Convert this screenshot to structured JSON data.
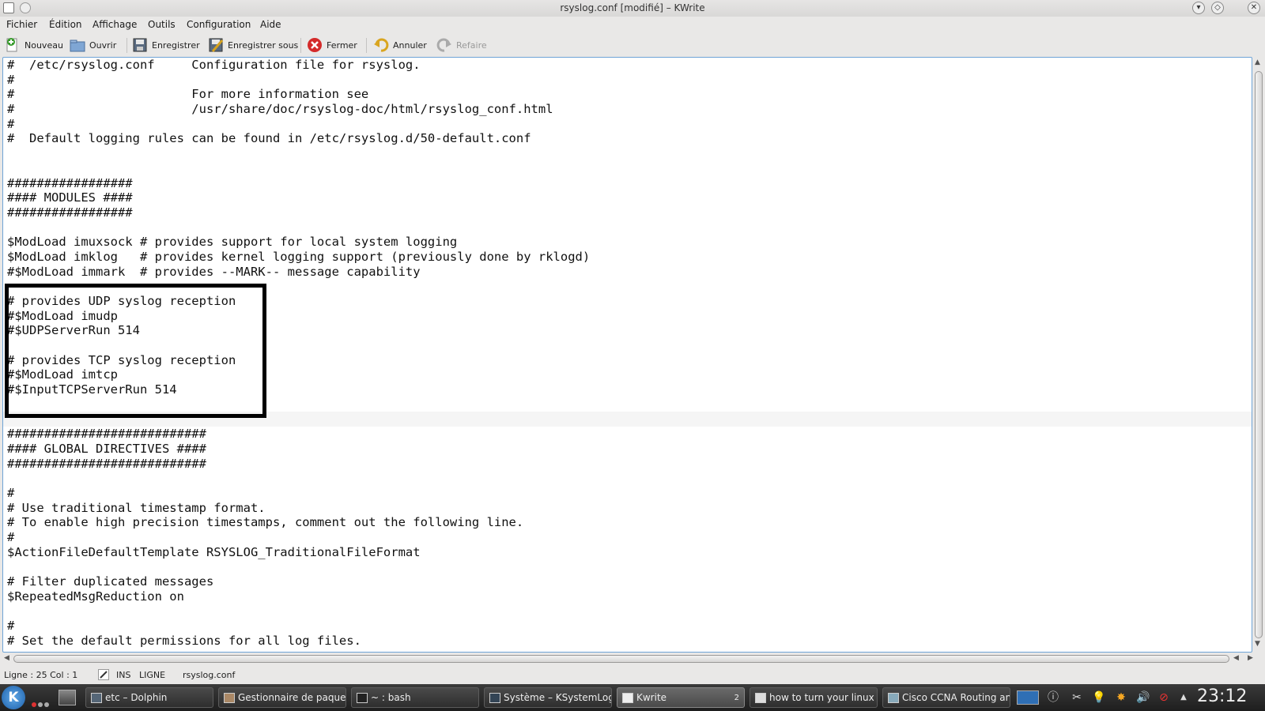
{
  "window": {
    "title": "rsyslog.conf [modifié] – KWrite"
  },
  "menu": {
    "items": [
      "Fichier",
      "Édition",
      "Affichage",
      "Outils",
      "Configuration",
      "Aide"
    ]
  },
  "toolbar": {
    "new_label": "Nouveau",
    "open_label": "Ouvrir",
    "save_label": "Enregistrer",
    "save_as_label": "Enregistrer sous",
    "close_label": "Fermer",
    "undo_label": "Annuler",
    "redo_label": "Refaire"
  },
  "editor": {
    "lines": [
      "#  /etc/rsyslog.conf     Configuration file for rsyslog.",
      "#",
      "#                        For more information see",
      "#                        /usr/share/doc/rsyslog-doc/html/rsyslog_conf.html",
      "#",
      "#  Default logging rules can be found in /etc/rsyslog.d/50-default.conf",
      "",
      "",
      "#################",
      "#### MODULES ####",
      "#################",
      "",
      "$ModLoad imuxsock # provides support for local system logging",
      "$ModLoad imklog   # provides kernel logging support (previously done by rklogd)",
      "#$ModLoad immark  # provides --MARK-- message capability",
      "",
      "# provides UDP syslog reception",
      "#$ModLoad imudp",
      "#$UDPServerRun 514",
      "",
      "# provides TCP syslog reception",
      "#$ModLoad imtcp",
      "#$InputTCPServerRun 514",
      "",
      "",
      "###########################",
      "#### GLOBAL DIRECTIVES ####",
      "###########################",
      "",
      "#",
      "# Use traditional timestamp format.",
      "# To enable high precision timestamps, comment out the following line.",
      "#",
      "$ActionFileDefaultTemplate RSYSLOG_TraditionalFileFormat",
      "",
      "# Filter duplicated messages",
      "$RepeatedMsgReduction on",
      "",
      "#",
      "# Set the default permissions for all log files."
    ]
  },
  "statusbar": {
    "position": "Ligne : 25 Col : 1",
    "mode": "INS",
    "selection_mode": "LIGNE",
    "filename": "rsyslog.conf"
  },
  "taskbar": {
    "tasks": [
      "etc – Dolphin",
      "Gestionnaire de paqueta",
      "~ : bash",
      "Système – KSystemLog",
      "Kwrite",
      "how to turn your linux co",
      "Cisco CCNA Routing and"
    ],
    "kwrite_group_count": "2",
    "clock": "23:12"
  }
}
